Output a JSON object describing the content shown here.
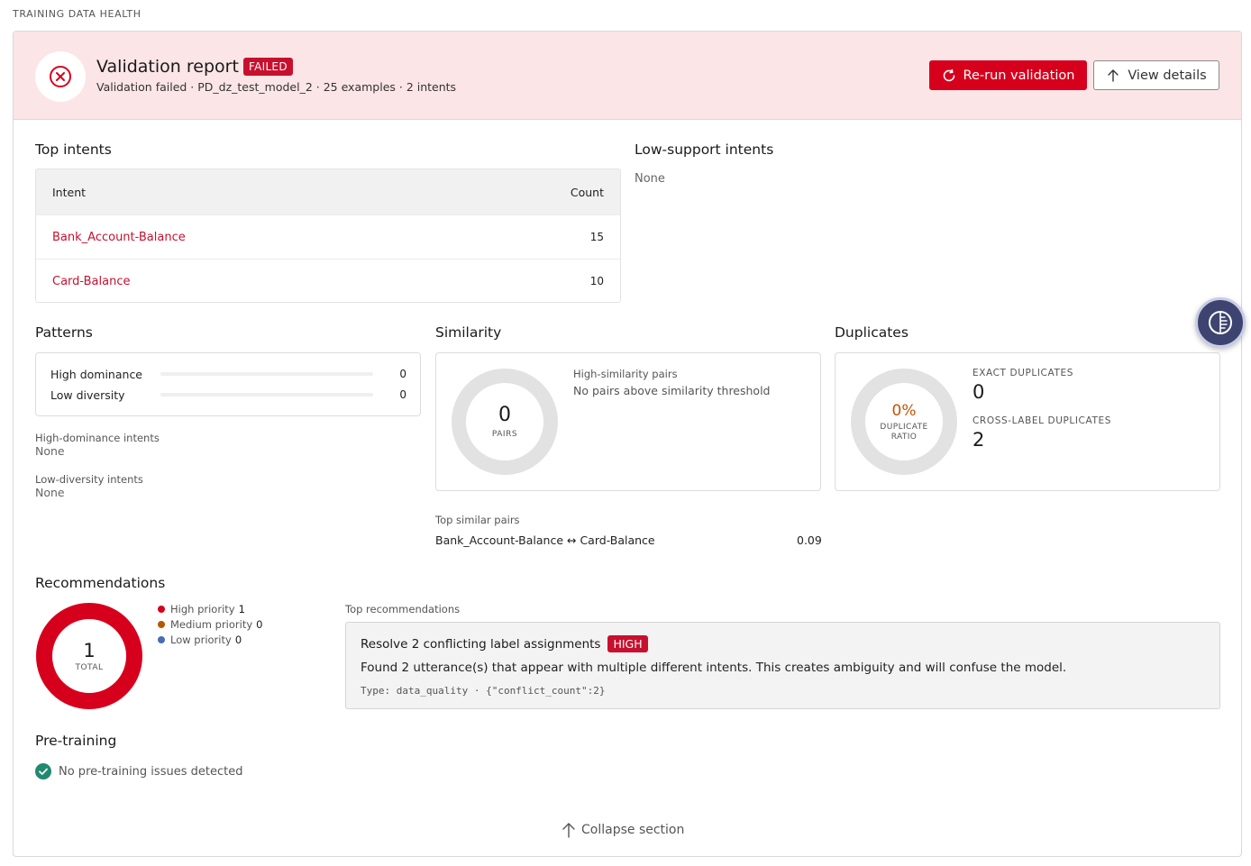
{
  "section_title": "TRAINING DATA HEALTH",
  "banner": {
    "title": "Validation report",
    "status_badge": "FAILED",
    "subtitle": "Validation failed · PD_dz_test_model_2 · 25 examples · 2 intents",
    "rerun_label": "Re-run validation",
    "details_label": "View details",
    "icon": "error-circle-icon"
  },
  "top_intents": {
    "title": "Top intents",
    "columns": [
      "Intent",
      "Count"
    ],
    "rows": [
      {
        "intent": "Bank_Account-Balance",
        "count": "15"
      },
      {
        "intent": "Card-Balance",
        "count": "10"
      }
    ]
  },
  "low_support": {
    "title": "Low-support intents",
    "value": "None"
  },
  "patterns": {
    "title": "Patterns",
    "rows": [
      {
        "label": "High dominance",
        "value": "0",
        "fraction": 0
      },
      {
        "label": "Low diversity",
        "value": "0",
        "fraction": 0
      }
    ],
    "high_dominance_label": "High-dominance intents",
    "high_dominance_value": "None",
    "low_diversity_label": "Low-diversity intents",
    "low_diversity_value": "None"
  },
  "similarity": {
    "title": "Similarity",
    "ring_value": "0",
    "ring_caption": "PAIRS",
    "pairs_label": "High-similarity pairs",
    "pairs_text": "No pairs above similarity threshold",
    "top_pairs_label": "Top similar pairs",
    "top_pairs": [
      {
        "pair": "Bank_Account-Balance ↔ Card-Balance",
        "score": "0.09"
      }
    ]
  },
  "duplicates": {
    "title": "Duplicates",
    "ratio_value": "0%",
    "ratio_caption_1": "DUPLICATE",
    "ratio_caption_2": "RATIO",
    "ratio_fraction": 0,
    "exact_label": "EXACT DUPLICATES",
    "exact_value": "0",
    "cross_label": "CROSS-LABEL DUPLICATES",
    "cross_value": "2"
  },
  "recommendations": {
    "title": "Recommendations",
    "total_value": "1",
    "total_caption": "TOTAL",
    "legend": [
      {
        "label": "High priority",
        "count": "1",
        "color": "#d7001c"
      },
      {
        "label": "Medium priority",
        "count": "0",
        "color": "#b35a00"
      },
      {
        "label": "Low priority",
        "count": "0",
        "color": "#4a6bb5"
      }
    ],
    "top_label": "Top recommendations",
    "items": [
      {
        "title": "Resolve 2 conflicting label assignments",
        "priority": "HIGH",
        "description": "Found 2 utterance(s) that appear with multiple different intents. This creates ambiguity and will confuse the model.",
        "meta": "Type: data_quality · {\"conflict_count\":2}"
      }
    ]
  },
  "pre_training": {
    "title": "Pre-training",
    "status": "No pre-training issues detected"
  },
  "collapse_label": "Collapse section",
  "colors": {
    "accent_red": "#d7001c",
    "banner_bg": "#fbe5e6",
    "success_green": "#1f8a70",
    "ratio_orange": "#c25400"
  }
}
